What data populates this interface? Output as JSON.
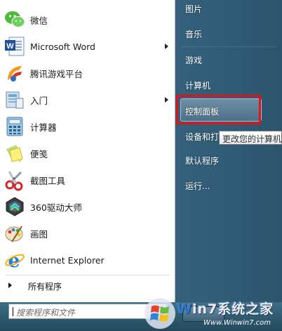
{
  "left_pane": {
    "programs": [
      {
        "label": "微信",
        "icon": "wechat-icon",
        "has_submenu": false
      },
      {
        "label": "Microsoft Word",
        "icon": "word-icon",
        "has_submenu": true
      },
      {
        "label": "腾讯游戏平台",
        "icon": "tencent-games-icon",
        "has_submenu": false
      },
      {
        "label": "入门",
        "icon": "getting-started-icon",
        "has_submenu": true
      },
      {
        "label": "计算器",
        "icon": "calculator-icon",
        "has_submenu": false
      },
      {
        "label": "便笺",
        "icon": "sticky-notes-icon",
        "has_submenu": false
      },
      {
        "label": "截图工具",
        "icon": "snipping-tool-icon",
        "has_submenu": false
      },
      {
        "label": "360驱动大师",
        "icon": "driver-master-icon",
        "has_submenu": false
      },
      {
        "label": "画图",
        "icon": "paint-icon",
        "has_submenu": false
      },
      {
        "label": "Internet Explorer",
        "icon": "internet-explorer-icon",
        "has_submenu": false
      }
    ],
    "all_programs": "所有程序",
    "search_placeholder": "搜索程序和文件"
  },
  "right_pane": {
    "items": [
      {
        "label": "图片"
      },
      {
        "label": "音乐"
      },
      {
        "label": "游戏"
      },
      {
        "label": "计算机"
      },
      {
        "label": "控制面板"
      },
      {
        "label": "设备和打"
      },
      {
        "label": "默认程序"
      },
      {
        "label": "运行..."
      }
    ],
    "highlighted": "控制面板",
    "tooltip": "更改您的计算机设"
  },
  "watermark": {
    "title_w": "W",
    "title_rest": "in7系统之家",
    "url": "Www.Winwin7.com"
  },
  "colors": {
    "highlight_border": "#e0131a",
    "right_pane_bg": "#2f5a74"
  }
}
